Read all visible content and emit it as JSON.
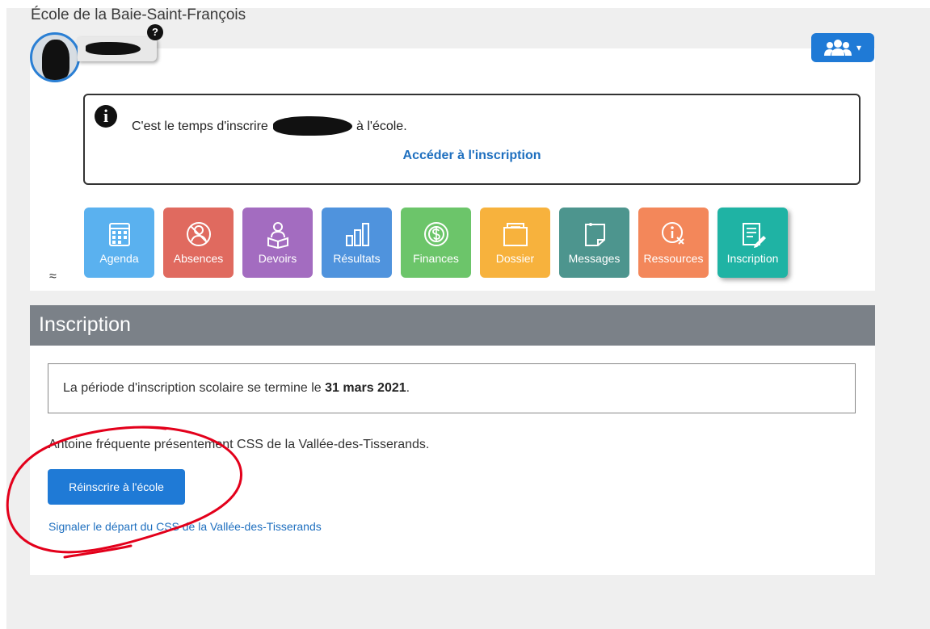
{
  "header": {
    "school_name": "École de la Baie-Saint-François"
  },
  "profile": {
    "help_badge": "?"
  },
  "family_menu": {
    "caret": "▾",
    "icon": "group-icon"
  },
  "notice": {
    "icon": "info-icon",
    "info_glyph": "i",
    "text_before": "C'est le temps d'inscrire",
    "text_after": "à l'école.",
    "link": "Accéder à l'inscription"
  },
  "modules": [
    {
      "label": "Agenda",
      "icon": "calendar-icon",
      "color": "#5ab1ef"
    },
    {
      "label": "Absences",
      "icon": "absences-icon",
      "color": "#e06a5f"
    },
    {
      "label": "Devoirs",
      "icon": "homework-icon",
      "color": "#a36cc0"
    },
    {
      "label": "Résultats",
      "icon": "chart-icon",
      "color": "#4f93dd"
    },
    {
      "label": "Finances",
      "icon": "dollar-icon",
      "color": "#6cc56a"
    },
    {
      "label": "Dossier",
      "icon": "folder-icon",
      "color": "#f7b23d"
    },
    {
      "label": "Messages",
      "icon": "note-icon",
      "color": "#4d958e"
    },
    {
      "label": "Ressources",
      "icon": "resources-icon",
      "color": "#f3875a"
    },
    {
      "label": "Inscription",
      "icon": "form-edit-icon",
      "color": "#1fb3a4"
    }
  ],
  "collapse_symbol": "≈",
  "section": {
    "title": "Inscription"
  },
  "period": {
    "text": "La période d'inscription scolaire se termine le ",
    "date": "31 mars 2021",
    "end": "."
  },
  "attendance": {
    "text": "Antoine fréquente présentement CSS de la Vallée-des-Tisserands."
  },
  "buttons": {
    "reinscribe": "Réinscrire à l'école"
  },
  "links": {
    "depart": "Signaler le départ du CSS de la Vallée-des-Tisserands"
  },
  "colors": {
    "accent": "#1f7ad6",
    "link": "#1e6fbf",
    "section_header": "#7b8188",
    "annotation": "#e3001b"
  }
}
